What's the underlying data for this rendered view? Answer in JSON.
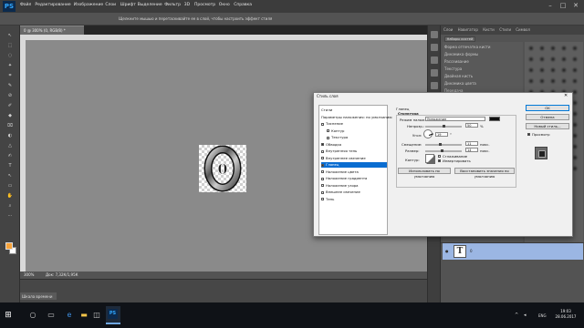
{
  "app": {
    "logo": "PS"
  },
  "menu": [
    "Файл",
    "Редактирование",
    "Изображение",
    "Слои",
    "Шрифт",
    "Выделение",
    "Фильтр",
    "3D",
    "Просмотр",
    "Окно",
    "Справка"
  ],
  "window_controls": {
    "minimize": "–",
    "maximize": "□",
    "close": "✕"
  },
  "options_bar": {
    "hint": "Щелкните мышью и перетаскивайте ее в слой, чтобы настроить эффект стиля"
  },
  "document": {
    "tab": "0 @ 300% (0, RGB/8) *",
    "zoom": "300%",
    "doc_size": "Док: 7,32К/1,95К",
    "canvas_glyph": "0"
  },
  "timeline": {
    "tab": "Шкала времени"
  },
  "right_panels": {
    "tabs": [
      "Слои",
      "Навигатор",
      "Кисти",
      "Стили",
      "Символ"
    ],
    "brush_presets_button": "Наборы кистей",
    "brush_options": [
      "Форма отпечатка кисти",
      "Динамика формы",
      "Рассеивание",
      "Текстура",
      "Двойная кисть",
      "Динамика цвета",
      "Передача",
      "Поза кисти",
      "Шум",
      "Влажные края",
      "Накопление",
      "Сглаживание",
      "Защита текстуры"
    ]
  },
  "layers": {
    "items": [
      {
        "name": "0",
        "thumb": "T",
        "visible_icon": "eye-icon"
      }
    ]
  },
  "dialog": {
    "title": "Стиль слоя",
    "close": "✕",
    "style_list": [
      {
        "label": "Стили",
        "checkbox": false,
        "selected": false
      },
      {
        "label": "Параметры наложения: по умолчанию",
        "checkbox": false,
        "selected": false
      },
      {
        "label": "Тиснение",
        "checkbox": true,
        "checked": false,
        "selected": false
      },
      {
        "label": "Контур",
        "checkbox": true,
        "checked": false,
        "selected": false,
        "indent": true
      },
      {
        "label": "Текстура",
        "checkbox": true,
        "checked": false,
        "selected": false,
        "indent": true
      },
      {
        "label": "Обводка",
        "checkbox": true,
        "checked": true,
        "selected": false
      },
      {
        "label": "Внутренняя тень",
        "checkbox": true,
        "checked": false,
        "selected": false
      },
      {
        "label": "Внутреннее свечение",
        "checkbox": true,
        "checked": false,
        "selected": false
      },
      {
        "label": "Глянец",
        "checkbox": true,
        "checked": true,
        "selected": true
      },
      {
        "label": "Наложение цвета",
        "checkbox": true,
        "checked": false,
        "selected": false
      },
      {
        "label": "Наложение градиента",
        "checkbox": true,
        "checked": false,
        "selected": false
      },
      {
        "label": "Наложение узора",
        "checkbox": true,
        "checked": false,
        "selected": false
      },
      {
        "label": "Внешнее свечение",
        "checkbox": true,
        "checked": false,
        "selected": false
      },
      {
        "label": "Тень",
        "checkbox": true,
        "checked": false,
        "selected": false
      }
    ],
    "section": {
      "title": "Глянец",
      "subtitle": "Структура",
      "blend_mode_label": "Режим наложения:",
      "blend_mode_value": "Умножение",
      "blend_color": "#111111",
      "opacity_label": "Непрозр.:",
      "opacity_value": "50",
      "opacity_fraction": 0.5,
      "percent": "%",
      "angle_label": "Угол:",
      "angle_value": "19",
      "angle_unit": "°",
      "distance_label": "Смещение:",
      "distance_value": "11",
      "distance_fraction": 0.4,
      "size_label": "Размер:",
      "size_value": "14",
      "size_fraction": 0.45,
      "px_unit": "пикс.",
      "contour_label": "Контур:",
      "antialias_label": "Сглаживание",
      "invert_label": "Инвертировать",
      "antialias_checked": false,
      "invert_checked": true,
      "make_default": "Использовать по умолчанию",
      "reset_default": "Восстановить значения по умолчанию"
    },
    "buttons": {
      "ok": "OK",
      "cancel": "Отмена",
      "new_style": "Новый стиль...",
      "preview_label": "Просмотр",
      "preview_checked": true
    }
  },
  "taskbar": {
    "start_icon": "windows-icon",
    "icons": [
      "search-icon",
      "task-view-icon",
      "edge-icon",
      "explorer-icon",
      "store-icon"
    ],
    "lang": "ENG",
    "time": "19:03",
    "date": "28.06.2017"
  }
}
